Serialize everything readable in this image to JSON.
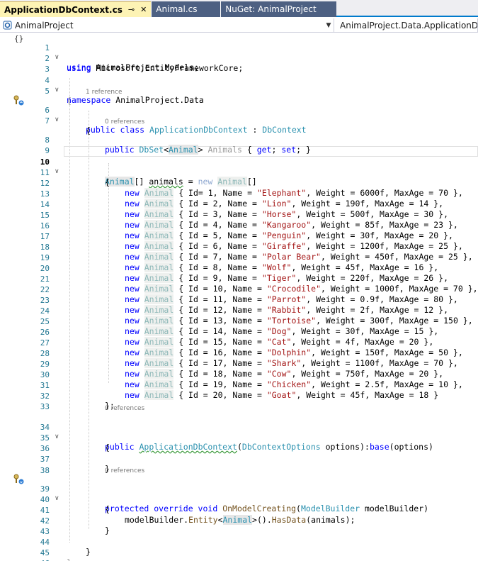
{
  "tabs": [
    {
      "label": "ApplicationDbContext.cs",
      "active": true,
      "pin": "⊸",
      "close": "✕"
    },
    {
      "label": "Animal.cs",
      "active": false
    },
    {
      "label": "NuGet: AnimalProject",
      "active": false
    }
  ],
  "nav": {
    "project": "AnimalProject",
    "member": "AnimalProject.Data.ApplicationDbContext"
  },
  "lens": {
    "ref1": "1 reference",
    "ref0": "0 references"
  },
  "colors": {
    "accent": "#007acc",
    "keyword": "#0000ff",
    "type": "#2b91af",
    "string": "#a31515"
  }
}
